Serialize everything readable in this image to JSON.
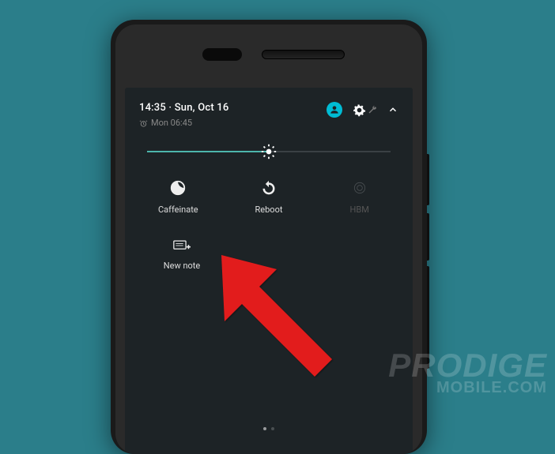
{
  "status": {
    "time_date": "14:35 · Sun, Oct 16",
    "alarm": "Mon 06:45"
  },
  "icons": {
    "account": "account-icon",
    "settings": "gear-icon",
    "tuner": "wrench-icon",
    "expand": "chevron-up",
    "alarm": "alarm-icon",
    "brightness": "brightness-icon"
  },
  "brightness": {
    "percent": 50
  },
  "tiles": [
    {
      "label": "Caffeinate",
      "icon": "caffeinate-icon",
      "enabled": true
    },
    {
      "label": "Reboot",
      "icon": "reboot-icon",
      "enabled": true
    },
    {
      "label": "HBM",
      "icon": "hbm-icon",
      "enabled": false
    }
  ],
  "tiles_row2": [
    {
      "label": "New note",
      "icon": "new-note-icon",
      "enabled": true
    }
  ],
  "watermark": {
    "line1": "PRODIGE",
    "line2": "MOBILE.COM"
  }
}
